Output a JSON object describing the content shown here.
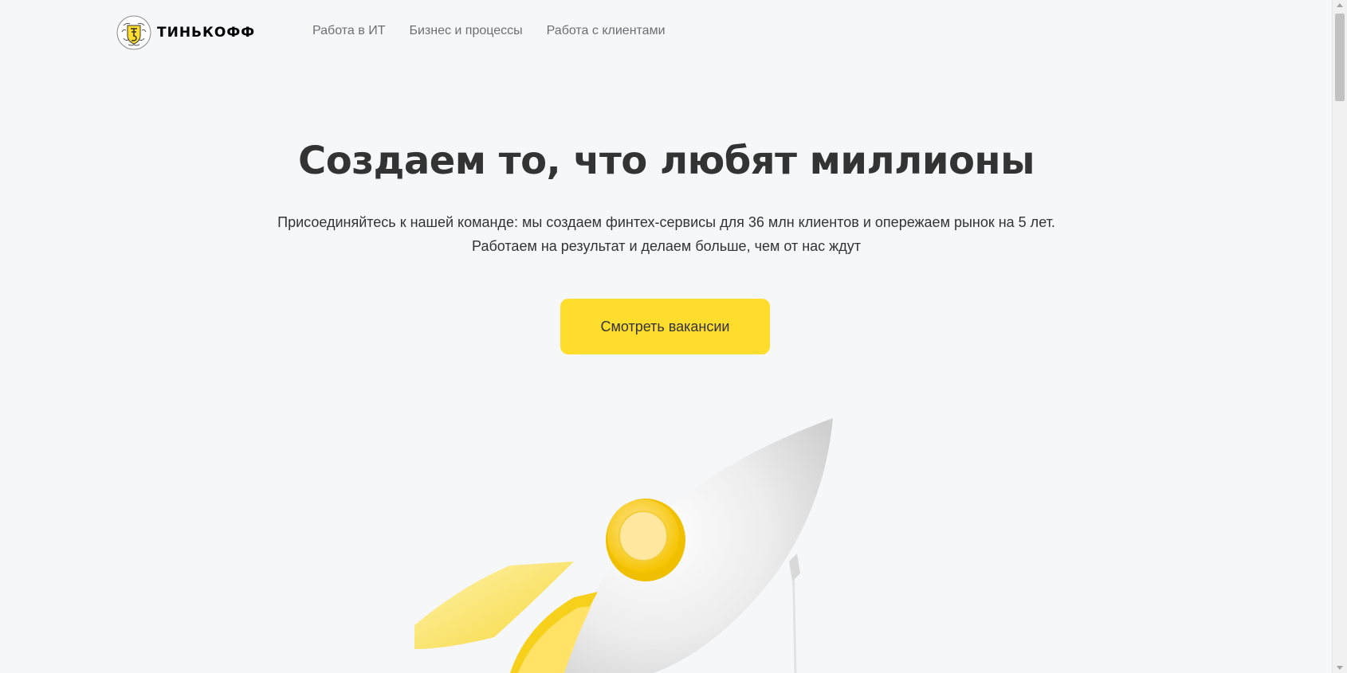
{
  "header": {
    "logo_text": "ТИНЬКОФФ",
    "nav": [
      {
        "label": "Работа в ИТ"
      },
      {
        "label": "Бизнес и процессы"
      },
      {
        "label": "Работа с клиентами"
      }
    ]
  },
  "hero": {
    "title": "Создаем то, что любят миллионы",
    "subtitle_line1": "Присоединяйтесь к нашей команде: мы создаем финтех-сервисы для 36 млн клиентов и опережаем рынок на 5 лет.",
    "subtitle_line2": "Работаем на результат и делаем больше, чем от нас ждут",
    "cta_label": "Смотреть вакансии"
  },
  "colors": {
    "background": "#f6f7f8",
    "accent_yellow": "#ffdd2d",
    "text": "#333333",
    "nav_text": "#6b6f74"
  },
  "icons": {
    "logo": "tinkoff-emblem-icon",
    "illustration": "rocket-illustration"
  }
}
